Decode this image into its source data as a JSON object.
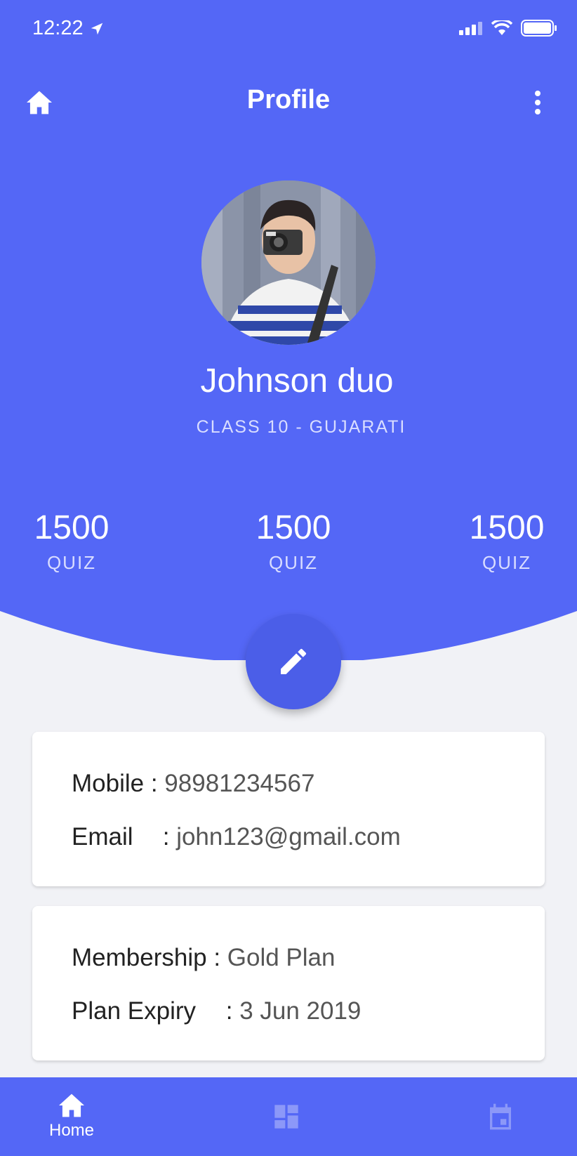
{
  "status_bar": {
    "time": "12:22"
  },
  "header": {
    "title": "Profile"
  },
  "profile": {
    "name": "Johnson duo",
    "class_label": "CLASS 10 - GUJARATI"
  },
  "stats": [
    {
      "value": "1500",
      "label": "QUIZ"
    },
    {
      "value": "1500",
      "label": "QUIZ"
    },
    {
      "value": "1500",
      "label": "QUIZ"
    }
  ],
  "contact": {
    "mobile_label": "Mobile",
    "mobile_value": "98981234567",
    "email_label": "Email",
    "email_value": "john123@gmail.com"
  },
  "membership": {
    "membership_label": "Membership",
    "membership_value": "Gold Plan",
    "expiry_label": "Plan Expiry",
    "expiry_value": "3 Jun 2019"
  },
  "bottom_nav": {
    "home_label": "Home"
  },
  "colors": {
    "primary": "#5467f6",
    "fab": "#4b5ee8",
    "background": "#f1f2f6",
    "subtle_text": "#d9ddff",
    "inactive_icon": "#8c98f8"
  },
  "icons": [
    "location-arrow-icon",
    "signal-icon",
    "wifi-icon",
    "battery-icon",
    "home-icon",
    "more-vertical-icon",
    "pencil-icon",
    "dashboard-icon",
    "calendar-icon"
  ]
}
